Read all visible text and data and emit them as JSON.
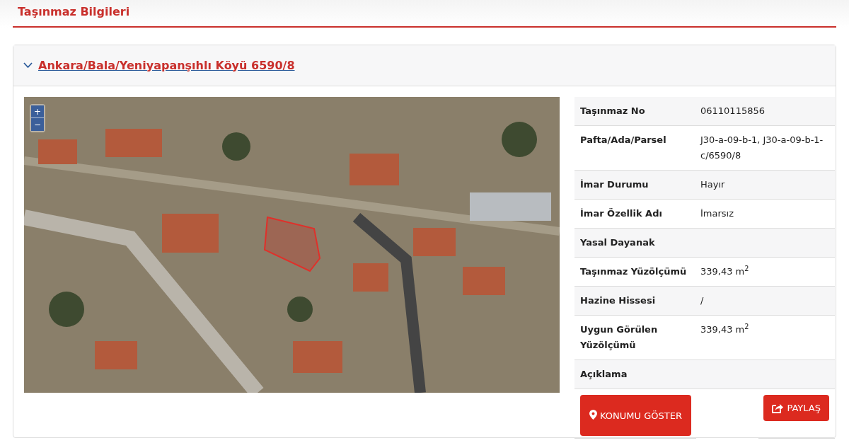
{
  "page_title": "Taşınmaz Bilgileri",
  "property": {
    "title": "Ankara/Bala/Yeniyapanşıhlı Köyü 6590/8",
    "expanded": true,
    "map": {
      "zoom_in": "+",
      "zoom_out": "−"
    },
    "details": [
      {
        "label": "Taşınmaz No",
        "value": "06110115856"
      },
      {
        "label": "Pafta/Ada/Parsel",
        "value": "J30-a-09-b-1, J30-a-09-b-1-c/6590/8"
      },
      {
        "label": "İmar Durumu",
        "value": "Hayır"
      },
      {
        "label": "İmar Özellik Adı",
        "value": "İmarsız"
      },
      {
        "label": "Yasal Dayanak"
      },
      {
        "label": "Taşınmaz Yüzölçümü",
        "value": "339,43 m$^{2}$"
      },
      {
        "label": "Hazine Hissesi",
        "value": "/"
      },
      {
        "label": "Uygun Görülen Yüzölçümü",
        "value": "339,43 m$^{2}$"
      },
      {
        "label": "Açıklama"
      }
    ],
    "buttons": [
      {
        "kind": "location",
        "label": "KONUMU GÖSTER"
      },
      {
        "kind": "share",
        "label": "PAYLAŞ"
      }
    ]
  }
}
